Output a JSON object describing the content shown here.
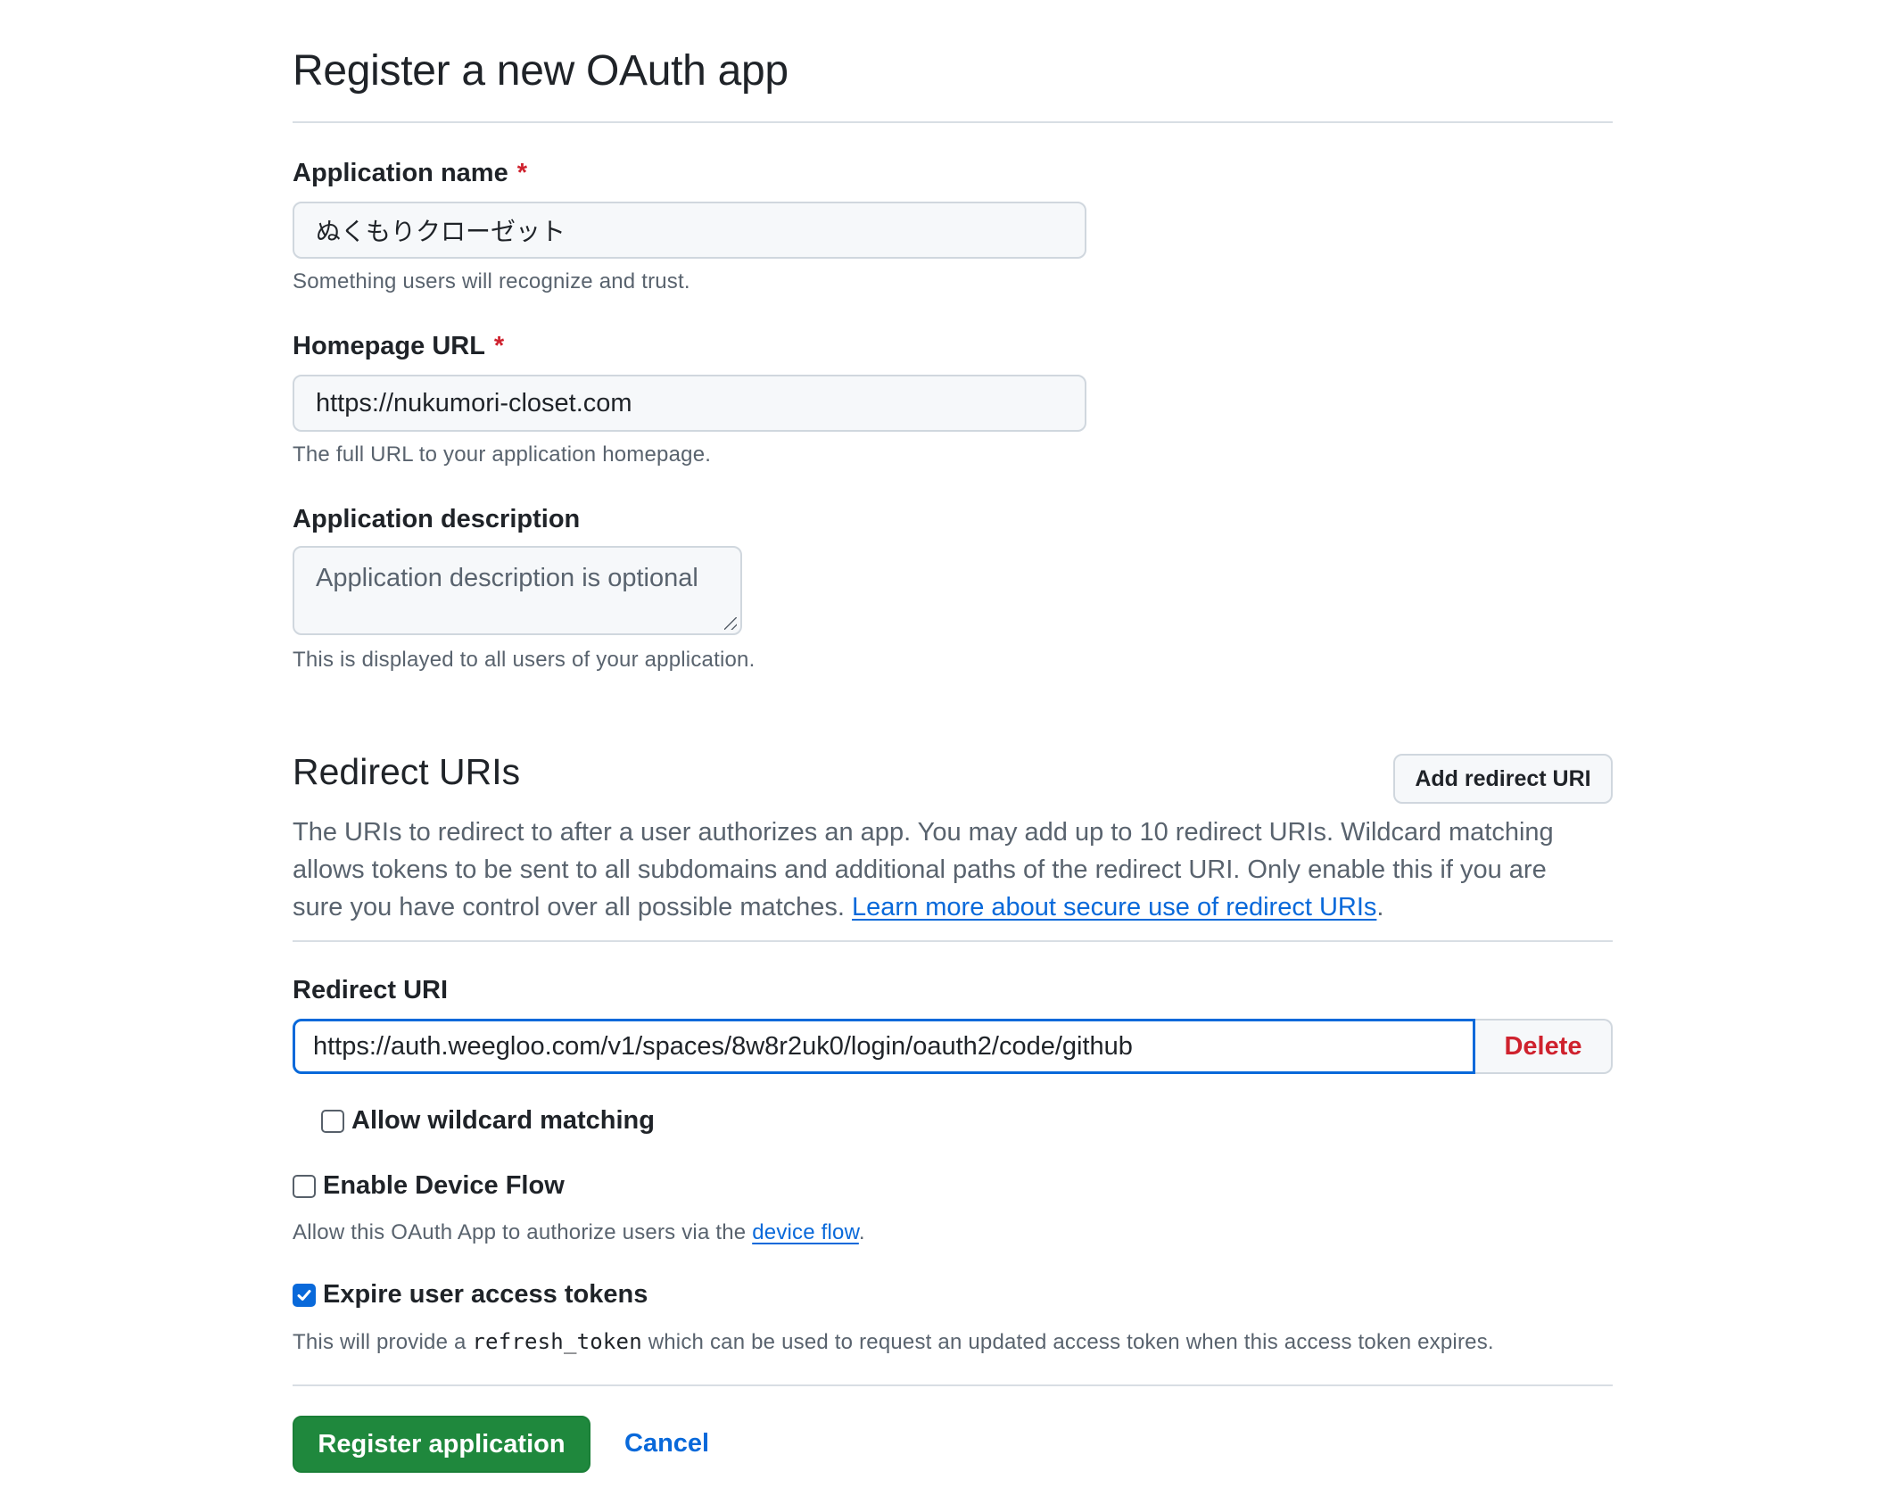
{
  "page": {
    "title": "Register a new OAuth app"
  },
  "form": {
    "app_name": {
      "label": "Application name",
      "required_mark": "*",
      "value": "ぬくもりクローゼット",
      "hint": "Something users will recognize and trust."
    },
    "homepage_url": {
      "label": "Homepage URL",
      "required_mark": "*",
      "value": "https://nukumori-closet.com",
      "hint": "The full URL to your application homepage."
    },
    "description": {
      "label": "Application description",
      "placeholder": "Application description is optional",
      "hint": "This is displayed to all users of your application."
    }
  },
  "redirect": {
    "heading": "Redirect URIs",
    "add_button": "Add redirect URI",
    "desc_text": "The URIs to redirect to after a user authorizes an app. You may add up to 10 redirect URIs. Wildcard matching allows tokens to be sent to all subdomains and additional paths of the redirect URI. Only enable this if you are sure you have control over all possible matches. ",
    "desc_link": "Learn more about secure use of redirect URIs",
    "desc_end": ".",
    "uri_label": "Redirect URI",
    "uri_value": "https://auth.weegloo.com/v1/spaces/8w8r2uk0/login/oauth2/code/github",
    "delete_button": "Delete",
    "wildcard": {
      "label": "Allow wildcard matching",
      "checked": false
    }
  },
  "device_flow": {
    "label": "Enable Device Flow",
    "checked": false,
    "hint_text": "Allow this OAuth App to authorize users via the ",
    "hint_link": "device flow",
    "hint_end": "."
  },
  "expire_tokens": {
    "label": "Expire user access tokens",
    "checked": true,
    "hint_pre": "This will provide a ",
    "hint_code": "refresh_token",
    "hint_post": " which can be used to request an updated access token when this access token expires."
  },
  "actions": {
    "register": "Register application",
    "cancel": "Cancel"
  },
  "colors": {
    "accent": "#0969da",
    "danger": "#cf222e",
    "primary_button": "#1f883d"
  }
}
